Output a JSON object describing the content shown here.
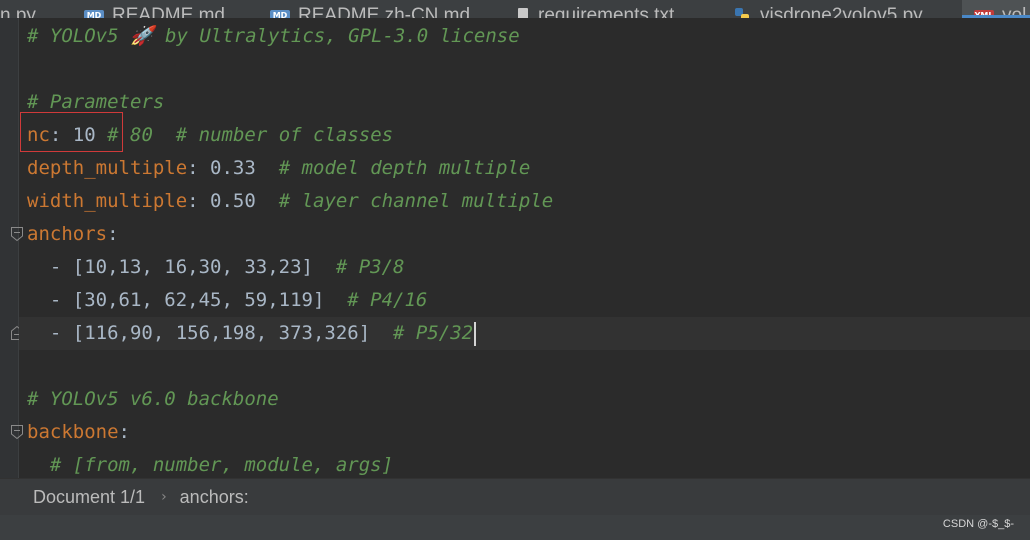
{
  "tabs": [
    {
      "label": "n.py",
      "icon": "python-file-icon"
    },
    {
      "label": "README.md",
      "icon": "markdown-file-icon",
      "badge": "MD"
    },
    {
      "label": "README.zh-CN.md",
      "icon": "markdown-file-icon",
      "badge": "MD"
    },
    {
      "label": "requirements.txt",
      "icon": "text-file-icon"
    },
    {
      "label": "visdrone2yolov5.py",
      "icon": "python-file-icon"
    },
    {
      "label": "yol",
      "icon": "yaml-file-icon",
      "badge": "YML",
      "active": true
    }
  ],
  "editor": {
    "lines": {
      "l1": {
        "comment": "# YOLOv5 🚀 by Ultralytics, GPL-3.0 license"
      },
      "l3": {
        "comment": "# Parameters"
      },
      "l4": {
        "key": "nc",
        "sep": ": ",
        "value": "10",
        "comment": "# 80  # number of classes"
      },
      "l5": {
        "key": "depth_multiple",
        "sep": ": ",
        "value": "0.33",
        "comment": "  # model depth multiple"
      },
      "l6": {
        "key": "width_multiple",
        "sep": ": ",
        "value": "0.50",
        "comment": "  # layer channel multiple"
      },
      "l7": {
        "key": "anchors",
        "sep": ":"
      },
      "l8": {
        "value": "  - [10,13, 16,30, 33,23]",
        "comment": "  # P3/8"
      },
      "l9": {
        "value": "  - [30,61, 62,45, 59,119]",
        "comment": "  # P4/16"
      },
      "l10": {
        "value": "  - [116,90, 156,198, 373,326]",
        "comment": "  # P5/32"
      },
      "l12": {
        "comment": "# YOLOv5 v6.0 backbone"
      },
      "l13": {
        "key": "backbone",
        "sep": ":"
      },
      "l14": {
        "comment": "  # [from, number, module, args]"
      }
    }
  },
  "breadcrumb": {
    "document": "Document 1/1",
    "separator": "›",
    "node": "anchors:"
  },
  "watermark": "CSDN @-$_$-",
  "colors": {
    "background": "#2b2b2b",
    "key": "#cc7832",
    "comment": "#629755",
    "text": "#a9b7c6",
    "highlight_box": "#d03a3a"
  }
}
